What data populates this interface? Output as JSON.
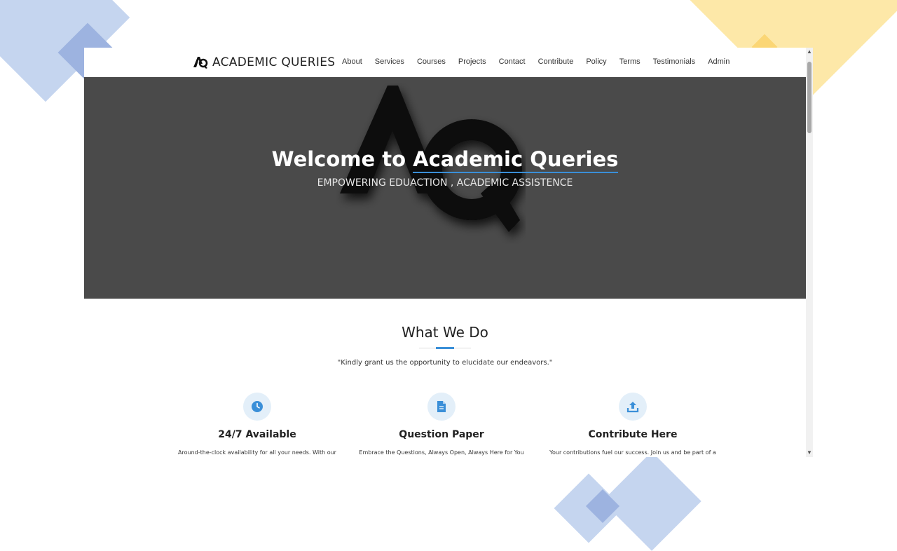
{
  "navbar": {
    "brand_text": "ACADEMIC QUERIES",
    "links": [
      "About",
      "Services",
      "Courses",
      "Projects",
      "Contact",
      "Contribute",
      "Policy",
      "Terms",
      "Testimonials",
      "Admin"
    ]
  },
  "hero": {
    "title_prefix": "Welcome to ",
    "title_accent": "Academic Queries",
    "subtitle": "EMPOWERING EDUACTION , ACADEMIC ASSISTENCE",
    "logo_icon": "aq-logo-icon"
  },
  "what_we_do": {
    "title": "What We Do",
    "quote": "\"Kindly grant us the opportunity to elucidate our endeavors.\"",
    "features": [
      {
        "icon": "clock-icon",
        "title": "24/7 Available",
        "desc": "Around-the-clock availability for all your needs. With our"
      },
      {
        "icon": "document-icon",
        "title": "Question Paper",
        "desc": "Embrace the Questions, Always Open, Always Here for You"
      },
      {
        "icon": "upload-icon",
        "title": "Contribute Here",
        "desc": "Your contributions fuel our success. Join us and be part of a"
      }
    ]
  },
  "colors": {
    "accent": "#3a8fd8",
    "hero_bg": "#4a4a4a",
    "icon_bg": "#e3eff9"
  }
}
